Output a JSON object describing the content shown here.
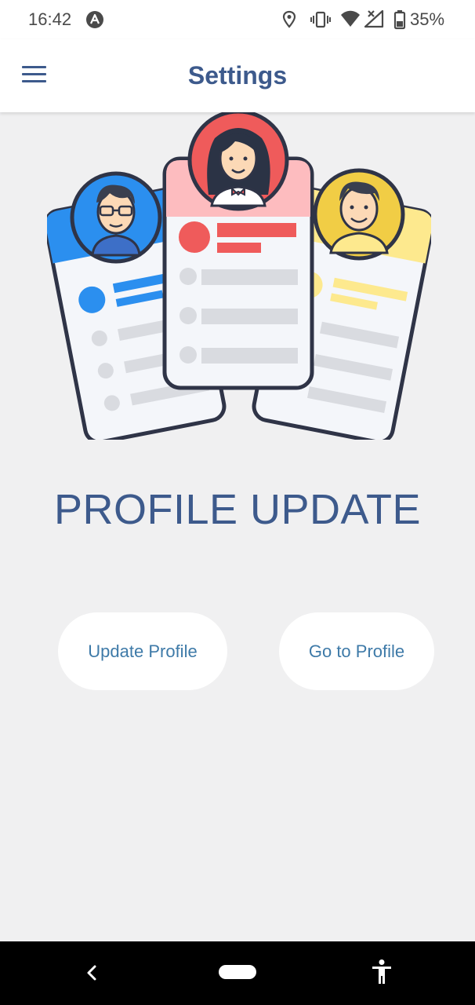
{
  "status_bar": {
    "time": "16:42",
    "battery_percent": "35%",
    "icons": [
      "app-notification-icon",
      "location-icon",
      "vibrate-icon",
      "wifi-icon",
      "signal-icon",
      "battery-icon"
    ]
  },
  "app_bar": {
    "title": "Settings",
    "menu_icon": "hamburger-menu-icon"
  },
  "illustration": {
    "description_icon": "profile-cards-illustration",
    "colors": {
      "blue_card": "#2b8fef",
      "pink_card": "#fdbcbf",
      "yellow_card": "#fde98e",
      "red_avatar": "#ef5b5b",
      "yellow_avatar": "#f1cd45",
      "outline": "#2f3447"
    }
  },
  "main": {
    "heading": "PROFILE UPDATE",
    "buttons": {
      "update_profile": "Update Profile",
      "go_to_profile": "Go to Profile"
    }
  },
  "nav_bar": {
    "icons": [
      "back-icon",
      "home-pill-icon",
      "accessibility-icon"
    ]
  },
  "theme": {
    "primary": "#3d5a8c",
    "button_text": "#3e7aa8",
    "background": "#f0f0f1"
  }
}
